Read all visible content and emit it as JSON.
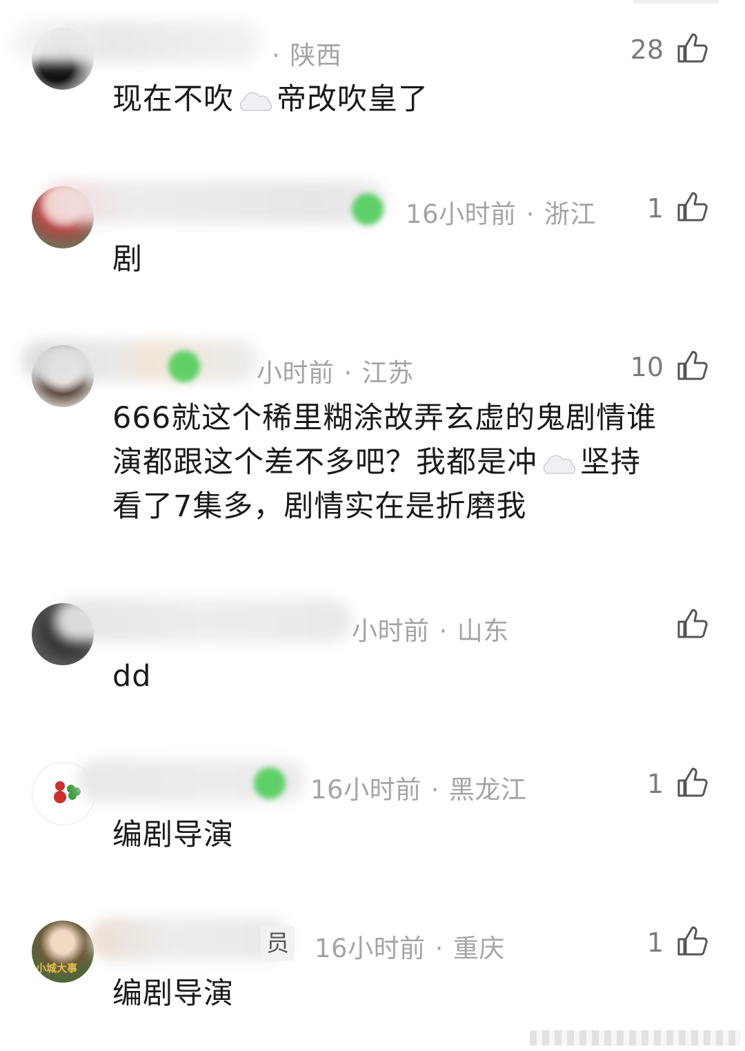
{
  "comments": [
    {
      "time": "",
      "location": "陕西",
      "likes": "28",
      "segments": [
        "现在不吹",
        "帝改吹皇了"
      ],
      "emoji": [
        "cloud"
      ]
    },
    {
      "time": "16小时前",
      "location": "浙江",
      "likes": "1",
      "text": "剧"
    },
    {
      "time": "小时前",
      "location": "江苏",
      "likes": "10",
      "line1": "666就这个稀里糊涂故弄玄虚的鬼剧情谁",
      "line2a": "演都跟这个差不多吧？我都是冲",
      "line2b": "坚持",
      "line3": "看了7集多，剧情实在是折磨我"
    },
    {
      "time": "小时前",
      "location": "山东",
      "likes": "",
      "text": "dd"
    },
    {
      "time": "16小时前",
      "location": "黑龙江",
      "likes": "1",
      "text": "编剧导演"
    },
    {
      "time": "16小时前",
      "location": "重庆",
      "likes": "1",
      "text": "编剧导演",
      "role_tag": "员",
      "avatar_caption": "小城大事"
    }
  ],
  "separator": "·",
  "icons": {
    "like": "thumbs-up-icon",
    "emoji": "cloud-emoji-icon"
  },
  "colors": {
    "meta": "#a4a4a4",
    "text": "#1a1a1a",
    "likes": "#7b7b7b",
    "badge": "#5fd068"
  }
}
